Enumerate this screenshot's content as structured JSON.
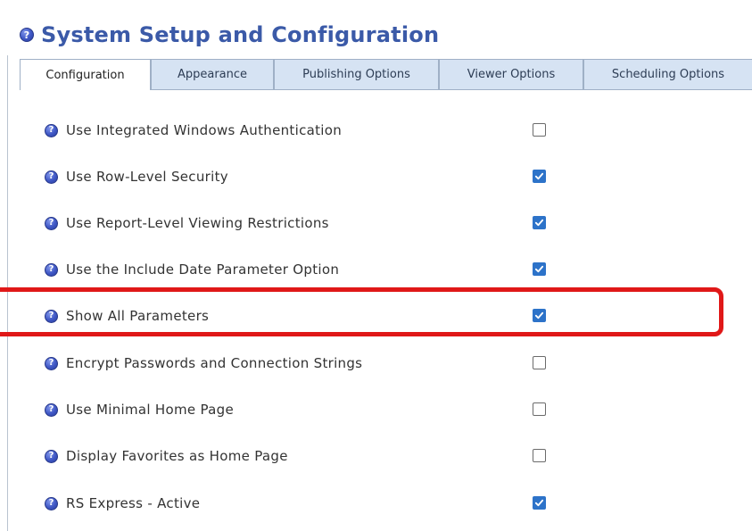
{
  "header": {
    "title": "System Setup and Configuration",
    "help_icon": "help-icon"
  },
  "tabs": [
    {
      "label": "Configuration",
      "active": true
    },
    {
      "label": "Appearance",
      "active": false
    },
    {
      "label": "Publishing Options",
      "active": false
    },
    {
      "label": "Viewer Options",
      "active": false
    },
    {
      "label": "Scheduling Options",
      "active": false
    }
  ],
  "settings": [
    {
      "label": "Use Integrated Windows Authentication",
      "checked": false
    },
    {
      "label": "Use Row-Level Security",
      "checked": true
    },
    {
      "label": "Use Report-Level Viewing Restrictions",
      "checked": true
    },
    {
      "label": "Use the Include Date Parameter Option",
      "checked": true
    },
    {
      "label": "Show All Parameters",
      "checked": true,
      "highlighted": true
    },
    {
      "label": "Encrypt Passwords and Connection Strings",
      "checked": false
    },
    {
      "label": "Use Minimal Home Page",
      "checked": false
    },
    {
      "label": "Display Favorites as Home Page",
      "checked": false
    },
    {
      "label": "RS Express - Active",
      "checked": true
    }
  ],
  "colors": {
    "accent": "#3b5aa8",
    "checkbox_checked": "#2d73c9",
    "highlight": "#e01818",
    "tab_bg": "#d6e3f3"
  }
}
